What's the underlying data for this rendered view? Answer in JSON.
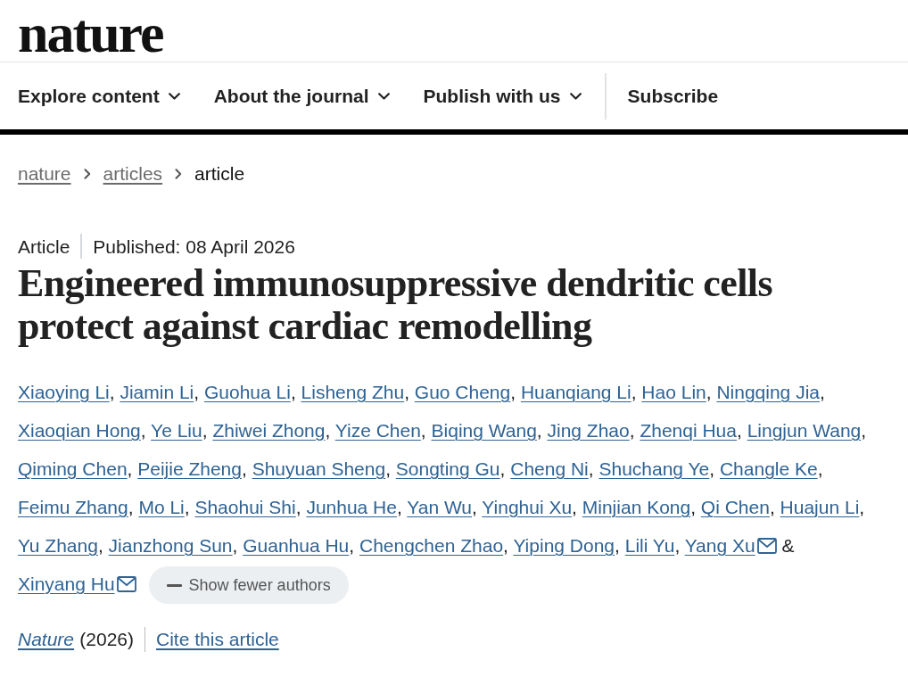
{
  "logo": {
    "text": "nature"
  },
  "nav": {
    "items": [
      {
        "label": "Explore content",
        "kind": "menu"
      },
      {
        "label": "About the journal",
        "kind": "menu"
      },
      {
        "label": "Publish with us",
        "kind": "menu"
      },
      {
        "label": "Subscribe",
        "kind": "link"
      }
    ]
  },
  "breadcrumb": [
    {
      "label": "nature",
      "current": false
    },
    {
      "label": "articles",
      "current": false
    },
    {
      "label": "article",
      "current": true
    }
  ],
  "article": {
    "type": "Article",
    "published": "Published: 08 April 2026",
    "title": "Engineered immunosuppressive dendritic cells protect against cardiac remodelling",
    "authors": [
      {
        "name": "Xiaoying Li",
        "sep": ","
      },
      {
        "name": "Jiamin Li",
        "sep": ","
      },
      {
        "name": "Guohua Li",
        "sep": ","
      },
      {
        "name": "Lisheng Zhu",
        "sep": ","
      },
      {
        "name": "Guo Cheng",
        "sep": ","
      },
      {
        "name": "Huanqiang Li",
        "sep": ","
      },
      {
        "name": "Hao Lin",
        "sep": ","
      },
      {
        "name": "Ningqing Jia",
        "sep": ","
      },
      {
        "name": "Xiaoqian Hong",
        "sep": ","
      },
      {
        "name": "Ye Liu",
        "sep": ","
      },
      {
        "name": "Zhiwei Zhong",
        "sep": ","
      },
      {
        "name": "Yize Chen",
        "sep": ","
      },
      {
        "name": "Biqing Wang",
        "sep": ","
      },
      {
        "name": "Jing Zhao",
        "sep": ","
      },
      {
        "name": "Zhenqi Hua",
        "sep": ","
      },
      {
        "name": "Lingjun Wang",
        "sep": ","
      },
      {
        "name": "Qiming Chen",
        "sep": ","
      },
      {
        "name": "Peijie Zheng",
        "sep": ","
      },
      {
        "name": "Shuyuan Sheng",
        "sep": ","
      },
      {
        "name": "Songting Gu",
        "sep": ","
      },
      {
        "name": "Cheng Ni",
        "sep": ","
      },
      {
        "name": "Shuchang Ye",
        "sep": ","
      },
      {
        "name": "Changle Ke",
        "sep": ","
      },
      {
        "name": "Feimu Zhang",
        "sep": ","
      },
      {
        "name": "Mo Li",
        "sep": ","
      },
      {
        "name": "Shaohui Shi",
        "sep": ","
      },
      {
        "name": "Junhua He",
        "sep": ","
      },
      {
        "name": "Yan Wu",
        "sep": ","
      },
      {
        "name": "Yinghui Xu",
        "sep": ","
      },
      {
        "name": "Minjian Kong",
        "sep": ","
      },
      {
        "name": "Qi Chen",
        "sep": ","
      },
      {
        "name": "Huajun Li",
        "sep": ","
      },
      {
        "name": "Yu Zhang",
        "sep": ","
      },
      {
        "name": "Jianzhong Sun",
        "sep": ","
      },
      {
        "name": "Guanhua Hu",
        "sep": ","
      },
      {
        "name": "Chengchen Zhao",
        "sep": ","
      },
      {
        "name": "Yiping Dong",
        "sep": ","
      },
      {
        "name": "Lili Yu",
        "sep": ","
      },
      {
        "name": "Yang Xu",
        "email": true,
        "sep": "&"
      },
      {
        "name": "Xinyang Hu",
        "email": true
      }
    ],
    "authors_button": "Show fewer authors",
    "journal": "Nature",
    "year": "(2026)",
    "cite": "Cite this article"
  }
}
